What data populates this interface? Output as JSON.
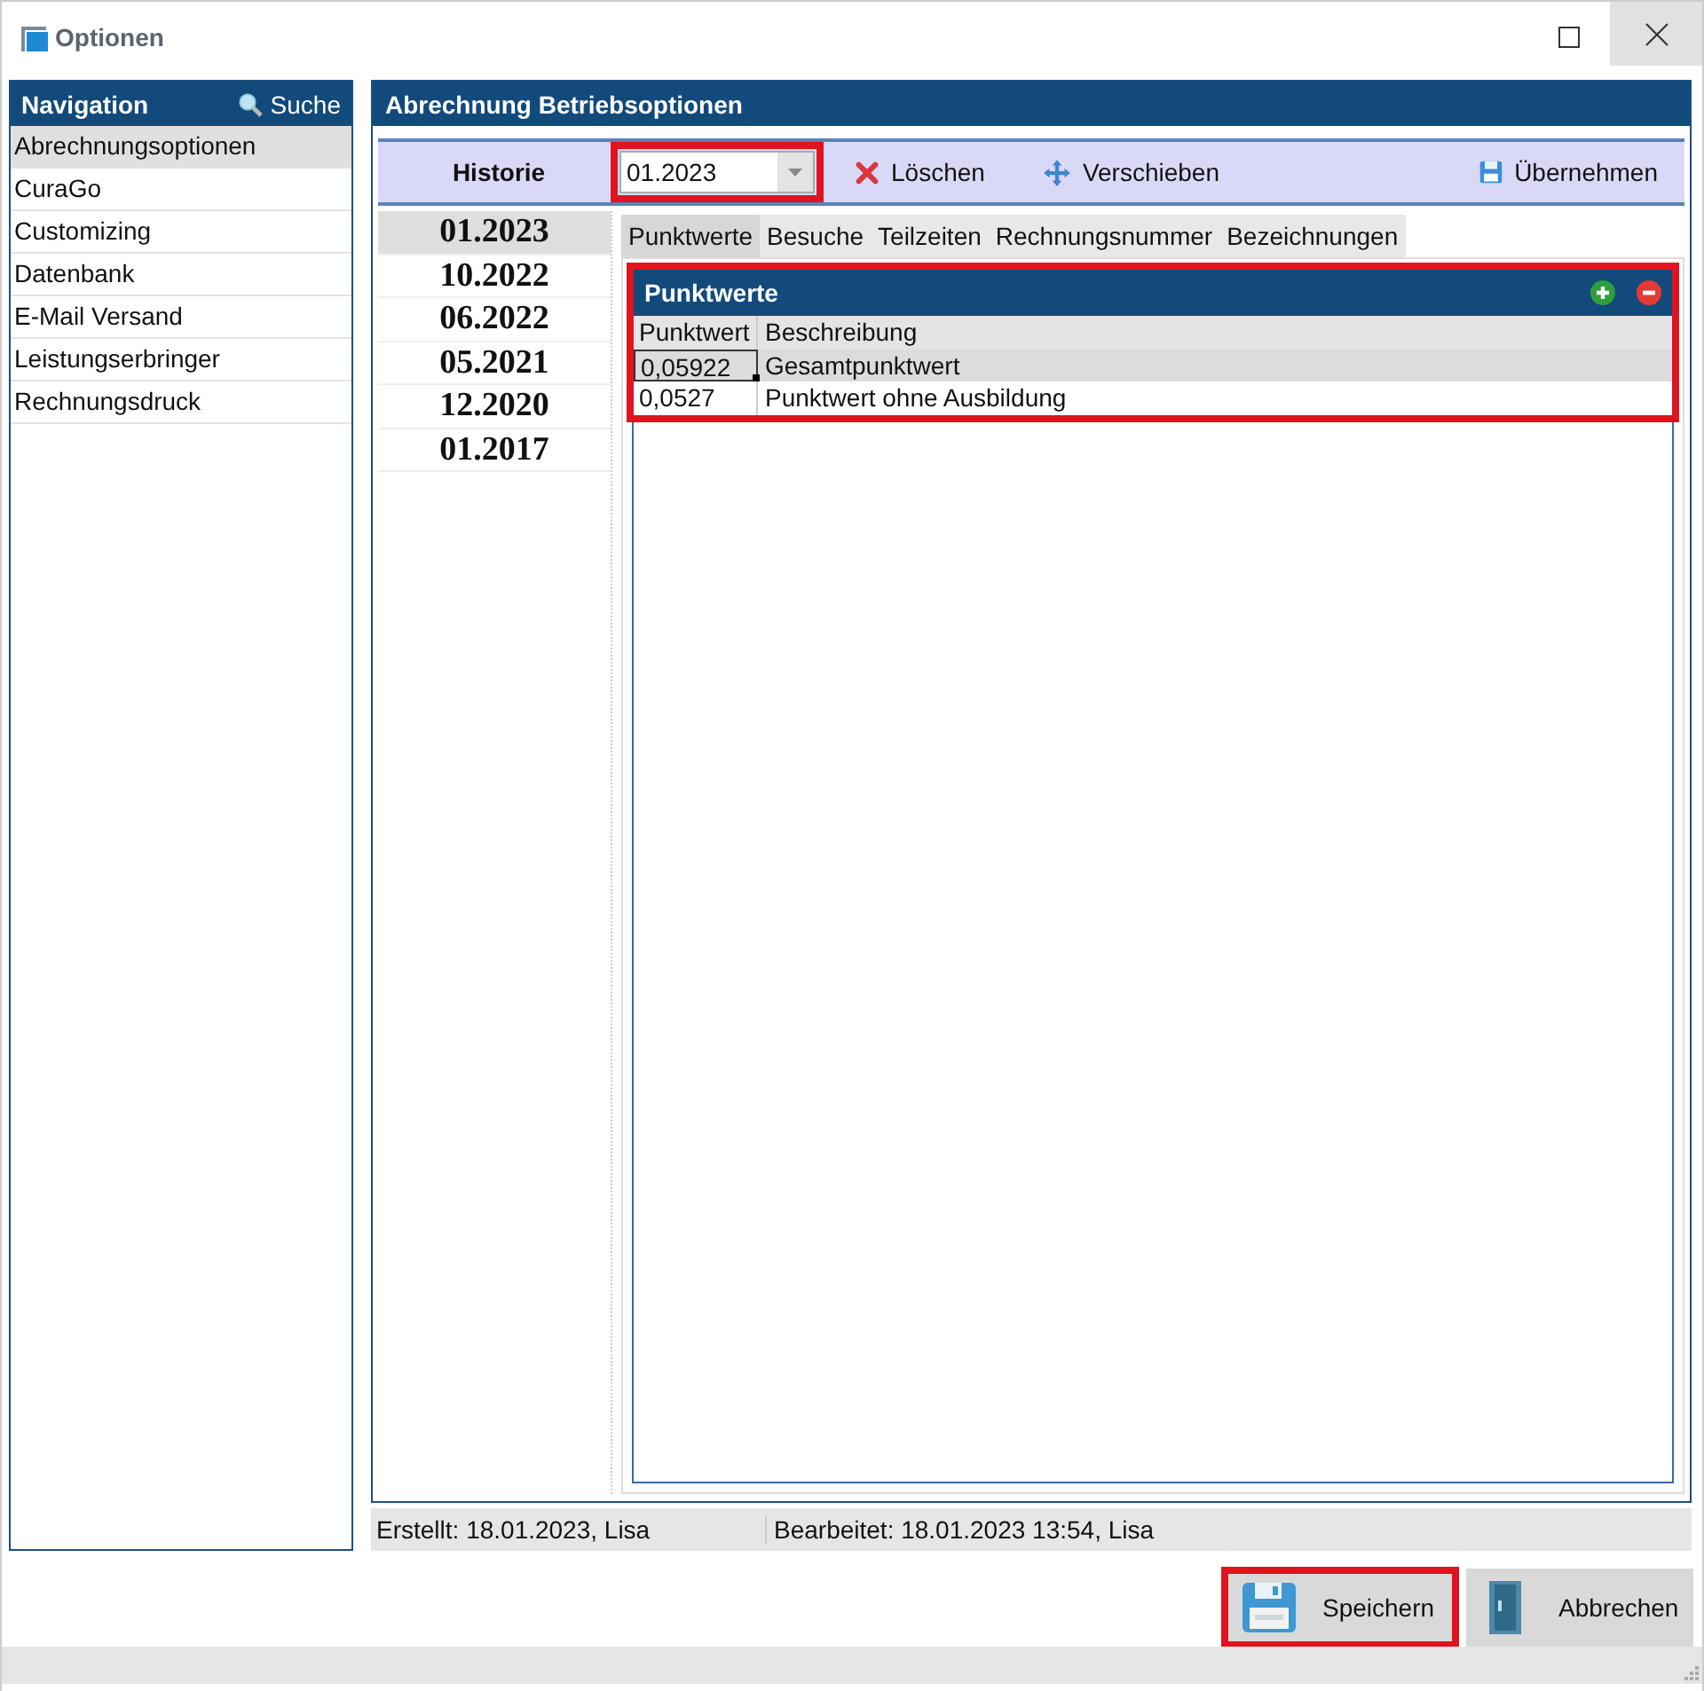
{
  "window": {
    "title": "Optionen"
  },
  "navigation": {
    "title": "Navigation",
    "search": "Suche",
    "items": [
      {
        "label": "Abrechnungsoptionen",
        "selected": true
      },
      {
        "label": "CuraGo",
        "selected": false
      },
      {
        "label": "Customizing",
        "selected": false
      },
      {
        "label": "Datenbank",
        "selected": false
      },
      {
        "label": "E-Mail Versand",
        "selected": false
      },
      {
        "label": "Leistungserbringer",
        "selected": false
      },
      {
        "label": "Rechnungsdruck",
        "selected": false
      }
    ]
  },
  "main": {
    "title": "Abrechnung Betriebsoptionen",
    "history_label": "Historie",
    "history_select": {
      "value": "01.2023",
      "highlighted": true
    },
    "toolbar": [
      {
        "label": "Löschen",
        "kind": "delete"
      },
      {
        "label": "Verschieben",
        "kind": "move"
      },
      {
        "label": "Übernehmen",
        "kind": "apply"
      }
    ],
    "history_items": [
      {
        "label": "01.2023",
        "selected": true
      },
      {
        "label": "10.2022",
        "selected": false
      },
      {
        "label": "06.2022",
        "selected": false
      },
      {
        "label": "05.2021",
        "selected": false
      },
      {
        "label": "12.2020",
        "selected": false
      },
      {
        "label": "01.2017",
        "selected": false
      }
    ],
    "tabs": [
      {
        "label": "Punktwerte",
        "selected": true
      },
      {
        "label": "Besuche",
        "selected": false
      },
      {
        "label": "Teilzeiten",
        "selected": false
      },
      {
        "label": "Rechnungsnummer",
        "selected": false
      },
      {
        "label": "Bezeichnungen",
        "selected": false
      }
    ],
    "table": {
      "title": "Punktwerte",
      "highlighted": true,
      "columns": [
        "Punktwert",
        "Beschreibung"
      ],
      "rows": [
        {
          "cells": [
            "0,05922",
            "Gesamtpunktwert"
          ],
          "selected": true
        },
        {
          "cells": [
            "0,0527",
            "Punktwert ohne Ausbildung"
          ],
          "selected": false
        }
      ]
    }
  },
  "status_bar": {
    "created": "Erstellt: 18.01.2023, Lisa",
    "edited": "Bearbeitet: 18.01.2023 13:54, Lisa"
  },
  "buttons": [
    {
      "label": "Speichern",
      "kind": "save",
      "highlighted": true
    },
    {
      "label": "Abbrechen",
      "kind": "cancel",
      "highlighted": false
    }
  ]
}
